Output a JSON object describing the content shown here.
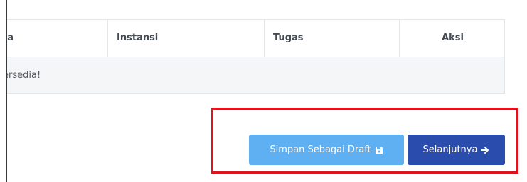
{
  "table": {
    "headers": [
      "na",
      "Instansi",
      "Tugas",
      "Aksi"
    ],
    "empty_message": "ersedia!"
  },
  "actions": {
    "draft_label": "Simpan Sebagai Draft",
    "next_label": "Selanjutnya"
  },
  "colors": {
    "draft_button": "#5fb0f2",
    "next_button": "#2a4cad",
    "highlight_border": "#e0141e"
  },
  "icons": {
    "draft": "floppy-disk-icon",
    "next": "arrow-right-icon"
  }
}
